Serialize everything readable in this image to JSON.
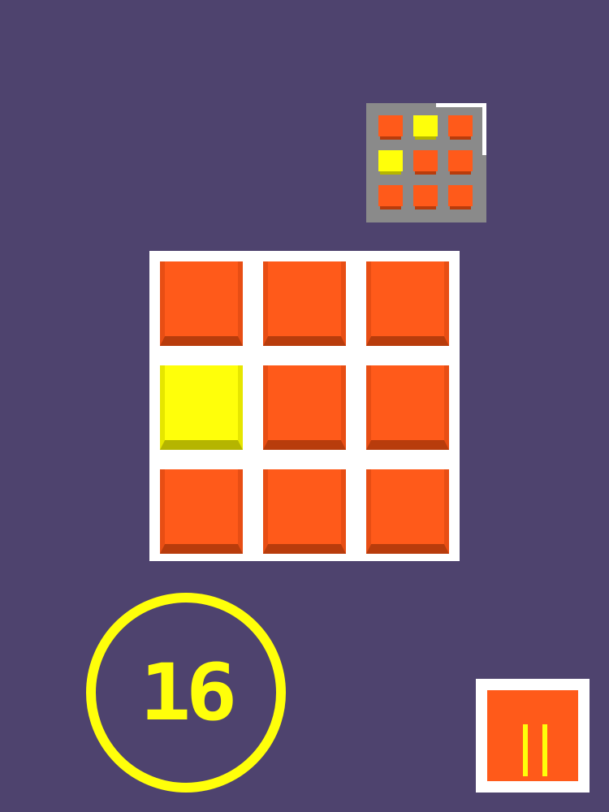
{
  "colors": {
    "background": "#4e436e",
    "tile_orange": "#ff5a1a",
    "tile_orange_shadow": "#b83c0c",
    "tile_orange_side": "#e84e14",
    "tile_yellow": "#ffff0a",
    "tile_yellow_shadow": "#b5b500",
    "tile_yellow_side": "#e6e600",
    "board": "#ffffff",
    "preview_bg": "#8a8a8a",
    "counter_ring": "#ffff0a"
  },
  "target_pattern": [
    [
      "orange",
      "yellow",
      "orange"
    ],
    [
      "yellow",
      "orange",
      "orange"
    ],
    [
      "orange",
      "orange",
      "orange"
    ]
  ],
  "board": [
    [
      "orange",
      "orange",
      "orange"
    ],
    [
      "yellow",
      "orange",
      "orange"
    ],
    [
      "orange",
      "orange",
      "orange"
    ]
  ],
  "moves_left": "16",
  "pause_icon": "pause-icon"
}
